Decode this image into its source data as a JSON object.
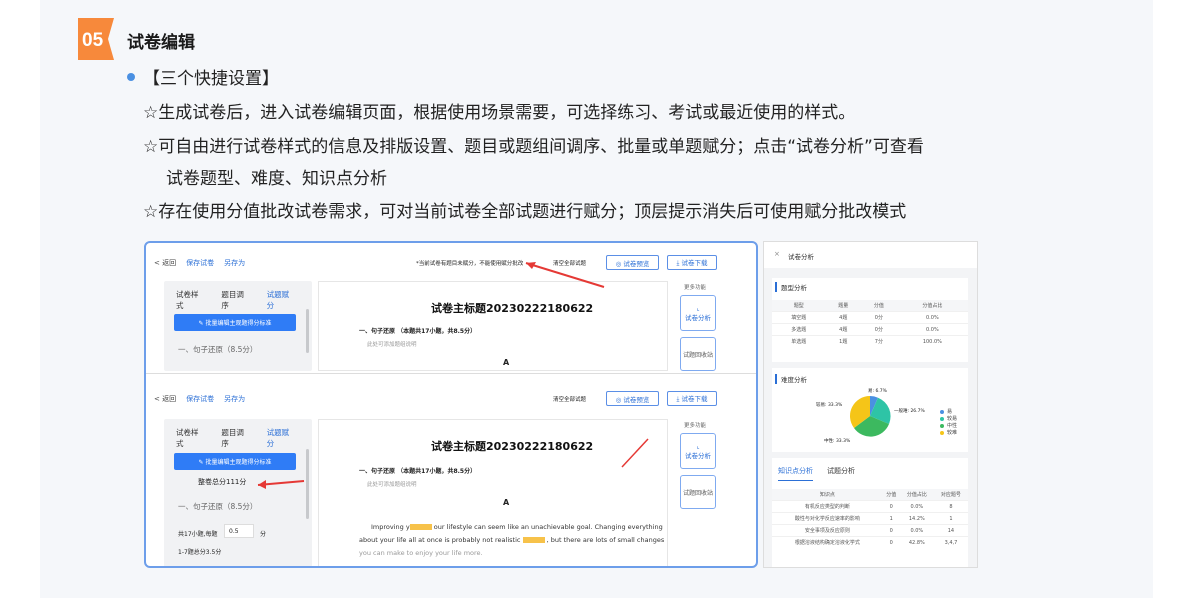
{
  "section": {
    "number": "05",
    "title": "试卷编辑"
  },
  "bullet": "【三个快捷设置】",
  "lines": [
    "☆生成试卷后，进入试卷编辑页面，根据使用场景需要，可选择练习、考试或最近使用的样式。",
    "☆可自由进行试卷样式的信息及排版设置、题目或题组间调序、批量或单题赋分；点击“试卷分析”可查看",
    "试卷题型、难度、知识点分析",
    "☆存在使用分值批改试卷需求，可对当前试卷全部试题进行赋分；顶层提示消失后可使用赋分批改模式"
  ],
  "editor": {
    "back": "< 返回",
    "save": "保存试卷",
    "save_as": "另存为",
    "warning": "*当前试卷有题目未赋分，不能使用赋分批改",
    "clear": "清空全部试题",
    "preview": "◎ 试卷预览",
    "download": "⤓ 试卷下载",
    "tabs": [
      "试卷样式",
      "题目调序",
      "试题赋分"
    ],
    "batch_btn": "✎ 批量编辑主观题得分标准",
    "section1": "一、句子还原（8.5分）",
    "total_score": "整卷总分111分",
    "per_q_label": "共17小题,每题",
    "per_q_value": "0.5",
    "per_q_unit": "分",
    "range": "1-7题总分3.5分",
    "more": "更多功能",
    "analysis": "试卷分析",
    "recycle": "试题回收站",
    "paper_title": "试卷主标题20230222180622",
    "q_heading": "一、句子还原  （本题共17小题，共8.5分）",
    "q_note": "此处可添加题组说明",
    "letter": "A",
    "eng": [
      "Improving y",
      " our lifestyle can seem like an unachievable goal. Changing everything",
      "about your life all at once is probably not realistic ",
      " , but there are lots of small changes",
      "you can make to enjoy your life more."
    ]
  },
  "side": {
    "title": "试卷分析",
    "type_title": "题型分析",
    "type_headers": [
      "题型",
      "题量",
      "分值",
      "分值占比"
    ],
    "type_rows": [
      [
        "填空题",
        "4题",
        "0分",
        "0.0%"
      ],
      [
        "多选题",
        "4题",
        "0分",
        "0.0%"
      ],
      [
        "单选题",
        "1题",
        "7分",
        "100.0%"
      ]
    ],
    "diff_title": "难度分析",
    "diff_labels": {
      "easy": "易: 6.7%",
      "hard": "较易: 33.3%",
      "mid": "一般难: 26.7%",
      "mid2": "中性: 33.3%"
    },
    "legend": [
      "易",
      "较易",
      "中性",
      "较难"
    ],
    "tabs": [
      "知识点分析",
      "试题分析"
    ],
    "kp_headers": [
      "知识点",
      "分值",
      "分值占比",
      "对应题号"
    ],
    "kp_rows": [
      [
        "有机反应类型的判断",
        "0",
        "0.0%",
        "8"
      ],
      [
        "酸性与对化学反应速率的影响",
        "1",
        "14.2%",
        "1"
      ],
      [
        "安全事项及反应原则",
        "0",
        "0.0%",
        "14"
      ],
      [
        "根据溶液结构确定溶液化学式",
        "0",
        "42.8%",
        "3,4,7"
      ]
    ]
  },
  "colors": {
    "accent": "#2b6fd6",
    "badge": "#f7893b",
    "warn": "#e53935"
  }
}
